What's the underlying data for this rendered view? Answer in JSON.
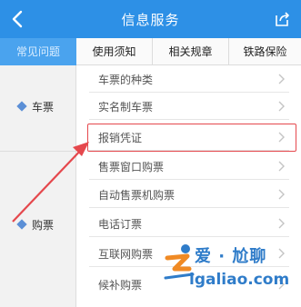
{
  "header": {
    "title": "信息服务",
    "back_icon": "back-chevron-icon",
    "share_icon": "share-icon"
  },
  "tabs": [
    {
      "label": "常见问题",
      "active": true
    },
    {
      "label": "使用须知",
      "active": false
    },
    {
      "label": "相关规章",
      "active": false
    },
    {
      "label": "铁路保险",
      "active": false
    }
  ],
  "categories": [
    {
      "label": "车票"
    },
    {
      "label": "购票"
    }
  ],
  "items": [
    {
      "label": "车票的种类"
    },
    {
      "label": "实名制车票"
    },
    {
      "label": "报销凭证",
      "highlighted": true
    },
    {
      "label": "售票窗口购票"
    },
    {
      "label": "自动售票机购票"
    },
    {
      "label": "电话订票"
    },
    {
      "label": "互联网购票"
    },
    {
      "label": "候补购票"
    }
  ],
  "watermark": {
    "text": "爱 · 尬聊",
    "url": "igaliao.com"
  },
  "colors": {
    "header_bg": "#2d90e6",
    "active_tab_bg": "#4aa3ee",
    "highlight": "#e5484d",
    "watermark": "#2f7cc9"
  }
}
